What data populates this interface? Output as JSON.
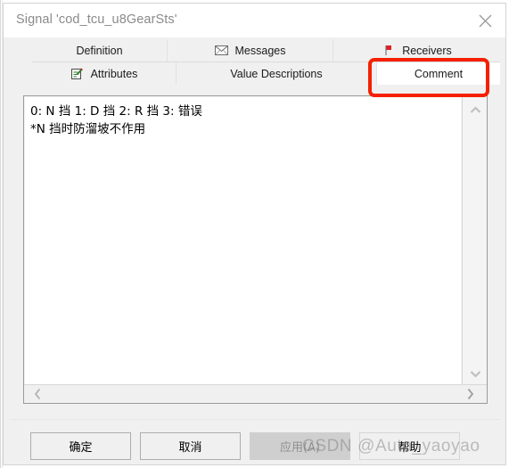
{
  "window": {
    "title": "Signal 'cod_tcu_u8GearSts'",
    "close_icon": "close-icon"
  },
  "tabs": {
    "row1": [
      {
        "label": "Definition",
        "icon": "",
        "selected": false
      },
      {
        "label": "Messages",
        "icon": "envelope-icon",
        "selected": false
      },
      {
        "label": "Receivers",
        "icon": "red-flag-icon",
        "selected": false
      }
    ],
    "row2": [
      {
        "label": "Attributes",
        "icon": "note-pencil-icon",
        "selected": false
      },
      {
        "label": "Value Descriptions",
        "icon": "",
        "selected": false
      },
      {
        "label": "Comment",
        "icon": "",
        "selected": true
      }
    ]
  },
  "annotation": {
    "target": "Comment",
    "color": "#f52000"
  },
  "comment_editor": {
    "lines": [
      "0: N 挡 1: D 挡 2: R 挡 3: 错误",
      "*N 挡时防溜坡不作用"
    ],
    "scroll_up_icon": "chevron-up-icon",
    "scroll_down_icon": "chevron-down-icon",
    "scroll_left_icon": "chevron-left-icon",
    "scroll_right_icon": "chevron-right-icon"
  },
  "buttons": {
    "ok": "确定",
    "cancel": "取消",
    "apply": "应用(A)",
    "help": "帮助",
    "apply_disabled": true
  },
  "watermark": {
    "text": "CSDN @Auto_yaoyao"
  }
}
